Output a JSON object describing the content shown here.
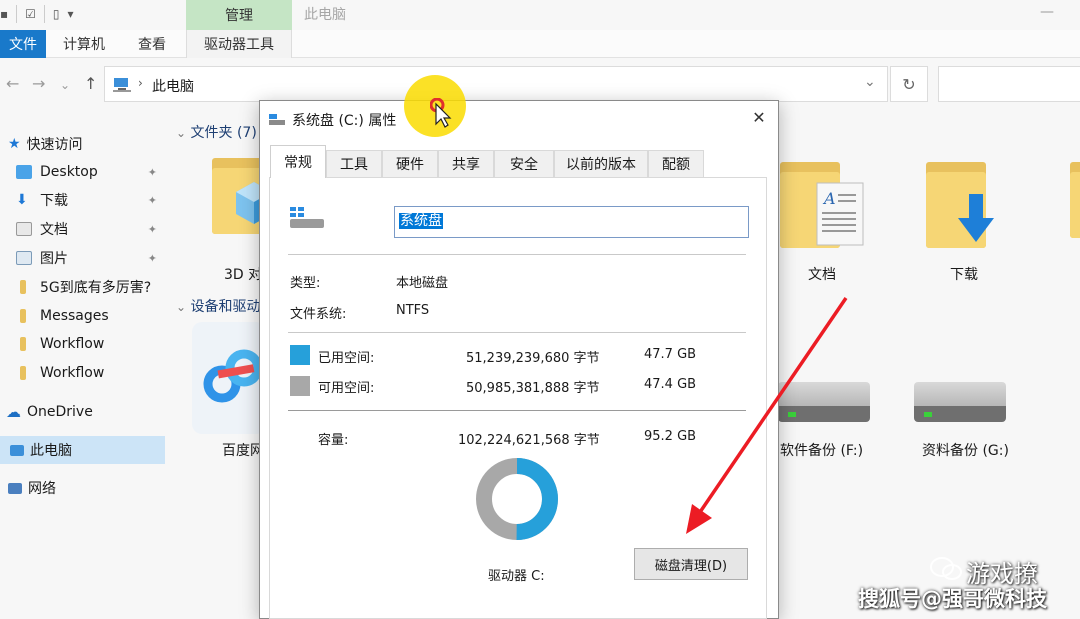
{
  "explorer": {
    "ribbon_context_tab": "管理",
    "window_title": "此电脑",
    "tabs": [
      "文件",
      "计算机",
      "查看",
      "驱动器工具"
    ],
    "address": "此电脑",
    "sidebar": [
      {
        "label": "快速访问",
        "icon": "star-icon"
      },
      {
        "label": "Desktop",
        "icon": "desktop-icon",
        "pinned": true
      },
      {
        "label": "下载",
        "icon": "download-arrow-icon",
        "pinned": true
      },
      {
        "label": "文档",
        "icon": "document-icon",
        "pinned": true
      },
      {
        "label": "图片",
        "icon": "picture-icon",
        "pinned": true
      },
      {
        "label": "5G到底有多厉害?",
        "icon": "folder-icon"
      },
      {
        "label": "Messages",
        "icon": "folder-icon"
      },
      {
        "label": "Workflow",
        "icon": "folder-icon"
      },
      {
        "label": "Workflow",
        "icon": "folder-icon"
      },
      {
        "label": "OneDrive",
        "icon": "cloud-icon"
      },
      {
        "label": "此电脑",
        "icon": "computer-icon",
        "selected": true
      },
      {
        "label": "网络",
        "icon": "network-icon"
      }
    ],
    "folders_header": "文件夹 (7)",
    "devices_header": "设备和驱动器",
    "folders": [
      {
        "label": "3D 对",
        "icon": "3d-objects-folder-icon"
      },
      {
        "label": "文档",
        "icon": "documents-folder-icon"
      },
      {
        "label": "下载",
        "icon": "downloads-folder-icon"
      }
    ],
    "drives": [
      {
        "label": "百度网",
        "icon": "baidu-netdisk-icon"
      },
      {
        "label": "软件备份 (F:)",
        "icon": "hard-drive-icon"
      },
      {
        "label": "资料备份 (G:)",
        "icon": "hard-drive-icon"
      }
    ]
  },
  "dialog": {
    "title": "系统盘 (C:) 属性",
    "tabs": [
      "常规",
      "工具",
      "硬件",
      "共享",
      "安全",
      "以前的版本",
      "配额"
    ],
    "active_tab": "常规",
    "volume_name": "系统盘",
    "type_label": "类型:",
    "type_value": "本地磁盘",
    "fs_label": "文件系统:",
    "fs_value": "NTFS",
    "used_label": "已用空间:",
    "used_bytes": "51,239,239,680 字节",
    "used_size": "47.7 GB",
    "free_label": "可用空间:",
    "free_bytes": "50,985,381,888 字节",
    "free_size": "47.4 GB",
    "capacity_label": "容量:",
    "capacity_bytes": "102,224,621,568 字节",
    "capacity_size": "95.2 GB",
    "drive_label": "驱动器 C:",
    "cleanup_button": "磁盘清理(D)",
    "used_fraction": 0.501,
    "used_color": "#26a0da",
    "free_color": "#a8a8a8"
  },
  "watermark": {
    "brand": "游戏撩",
    "line": "搜狐号@强哥微科技"
  }
}
